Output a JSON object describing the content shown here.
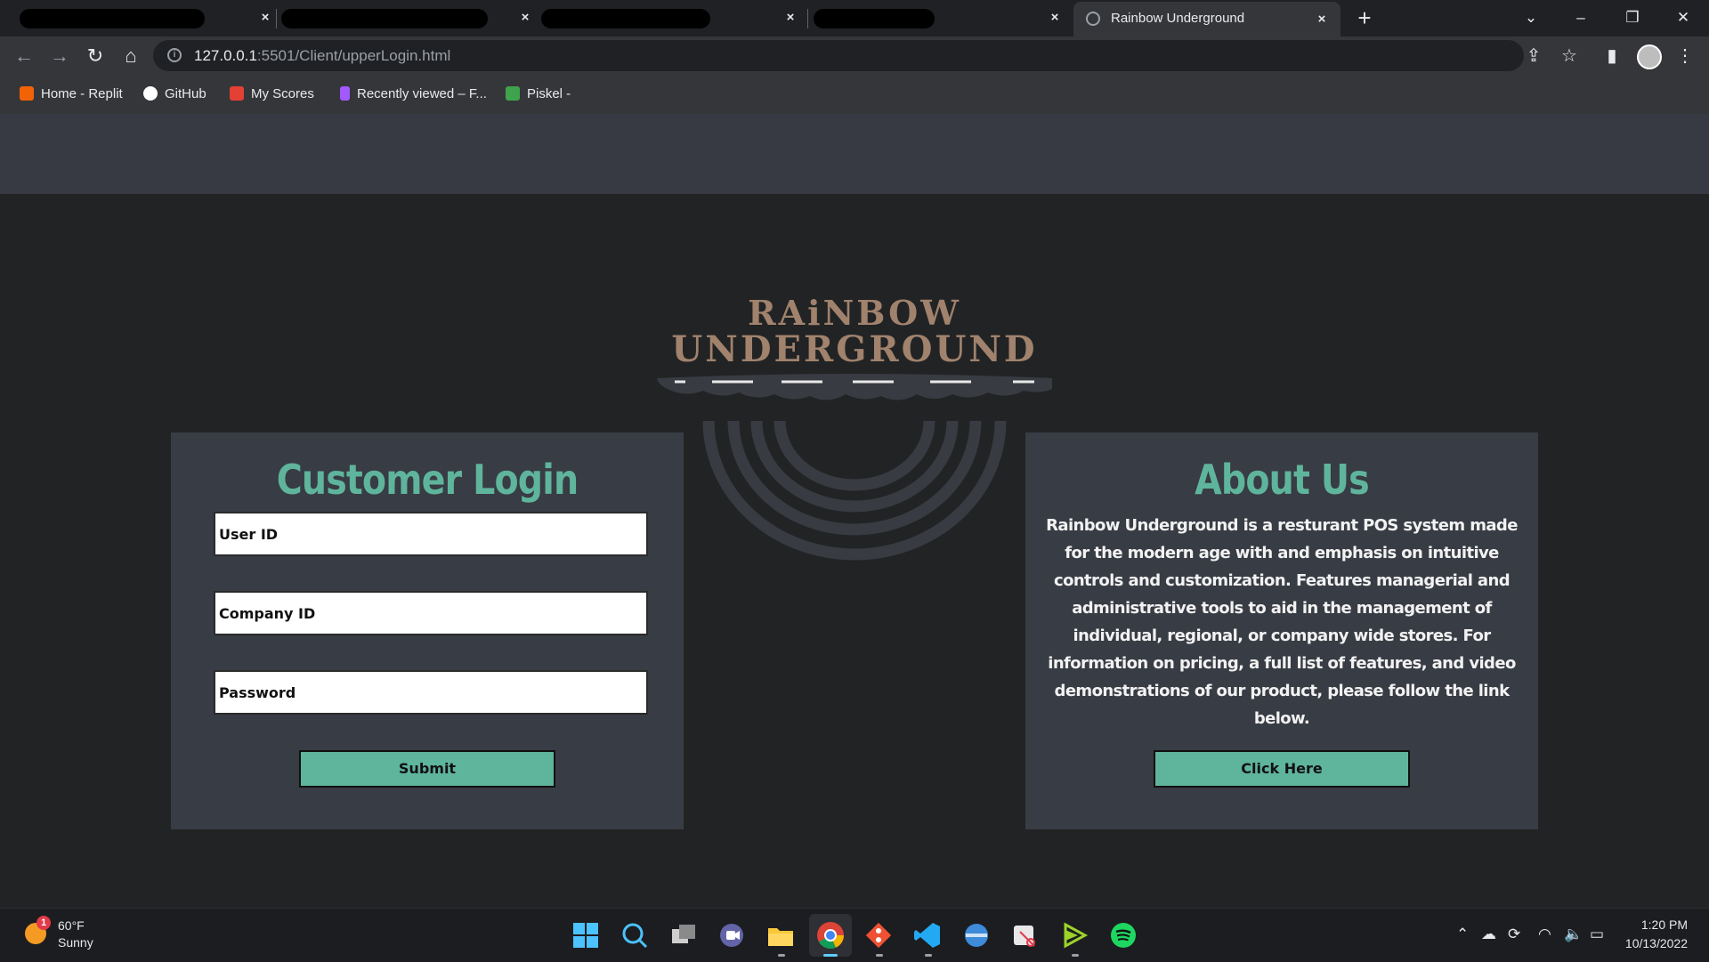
{
  "browser": {
    "active_tab_title": "Rainbow Underground",
    "url_host": "127.0.0.1",
    "url_path": ":5501/Client/upperLogin.html",
    "tab_close": "×",
    "new_tab": "+",
    "bookmarks": [
      {
        "label": "Home - Replit",
        "icon": "replit-icon",
        "color": "#f26207"
      },
      {
        "label": "GitHub",
        "icon": "github-icon",
        "color": "#ffffff"
      },
      {
        "label": "My Scores",
        "icon": "scores-icon",
        "color": "#e34133"
      },
      {
        "label": "Recently viewed – F...",
        "icon": "figma-icon",
        "color": "#a259ff"
      },
      {
        "label": "Piskel -",
        "icon": "piskel-icon",
        "color": "#3fa34d"
      }
    ]
  },
  "logo": {
    "line1": "RAiNBOW",
    "line2": "UNDERGROUND"
  },
  "login": {
    "title": "Customer Login",
    "user_id_placeholder": "User ID",
    "company_id_placeholder": "Company ID",
    "password_placeholder": "Password",
    "submit_label": "Submit"
  },
  "about": {
    "title": "About Us",
    "text": "Rainbow Underground is a resturant POS system made for the modern age with and emphasis on intuitive controls and customization. Features managerial and administrative tools to aid in the management of individual, regional, or company wide stores. For information on pricing, a full list of features, and video demonstrations of our product, please follow the link below.",
    "button_label": "Click Here"
  },
  "colors": {
    "accent": "#5fb49c",
    "card": "#383c44",
    "page": "#222324",
    "header": "#373a42",
    "logo": "#a0826d"
  },
  "taskbar": {
    "weather_badge": "1",
    "weather_temp": "60°F",
    "weather_cond": "Sunny",
    "time": "1:20 PM",
    "date": "10/13/2022"
  }
}
